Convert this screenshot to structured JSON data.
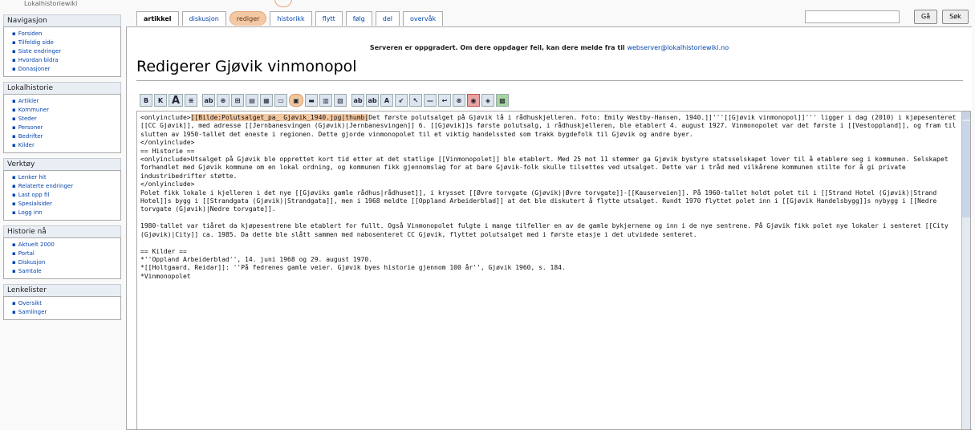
{
  "logo_text": "Lokalhistoriewiki",
  "sidebar": [
    {
      "heading": "Navigasjon",
      "items": [
        "Forsiden",
        "Tilfeldig side",
        "Siste endringer",
        "Hvordan bidra",
        "Donasjoner"
      ]
    },
    {
      "heading": "Lokalhistorie",
      "items": [
        "Artikler",
        "Kommuner",
        "Steder",
        "Personer",
        "Bedrifter",
        "Kilder"
      ]
    },
    {
      "heading": "Verktøy",
      "items": [
        "Lenker hit",
        "Relaterte endringer",
        "Last opp fil",
        "Spesialsider",
        "Logg inn"
      ]
    },
    {
      "heading": "Historie nå",
      "items": [
        "Aktuelt 2000",
        "Portal",
        "Diskusjon",
        "Samtale"
      ]
    },
    {
      "heading": "Lenkelister",
      "items": [
        "Oversikt",
        "Samlinger"
      ]
    }
  ],
  "tabs": [
    "artikkel",
    "diskusjon",
    "rediger",
    "historikk",
    "flytt",
    "følg",
    "del",
    "overvåk"
  ],
  "search": {
    "placeholder": "",
    "go_label": "Gå",
    "search_label": "Søk"
  },
  "notice": {
    "text": "Serveren er oppgradert. Om dere oppdager feil, kan dere melde fra til ",
    "link": "webserver@lokalhistoriewiki.no"
  },
  "page_title": "Redigerer Gjøvik vinmonopol",
  "toolbar": [
    "B",
    "K",
    "A",
    "≡",
    "ab",
    "⊕",
    "⊞",
    "▤",
    "▦",
    "▭",
    "▣",
    "▬",
    "▥",
    "▧",
    "ab",
    "ab",
    "A",
    "↙",
    "↖",
    "—",
    "↩",
    "⊗",
    "◉",
    "◈",
    "▩"
  ],
  "editor": {
    "hl": "[[Bilde:Polutsalget_pa_ Gjøvik_1940.jpg|thumb|",
    "pre": "<onlyinclude>",
    "post": "Det første polutsalget på Gjøvik lå i rådhuskjelleren. Foto: Emily Westby-Hansen, 1940.]]'''[[Gjøvik vinmonopol]]''' ligger i dag (2010) i kjøpesenteret [[CC Gjøvik]], med adresse [[Jernbanesvingen (Gjøvik)|Jernbanesvingen]] 6. [[Gjøvik]]s første polutsalg, i rådhuskjelleren, ble etablert 4. august 1927. Vinmonopolet var det første i [[Vestoppland]], og fram til slutten av 1950-tallet det eneste i regionen. Dette gjorde vinmonopolet til et viktig handelssted som trakk bygdefolk til Gjøvik og andre byer.\n</onlyinclude>\n== Historie ==\n<onlyinclude>Utsalget på Gjøvik ble opprettet kort tid etter at det statlige [[Vinmonopolet]] ble etablert. Med 25 mot 11 stemmer ga Gjøvik bystyre statsselskapet lover til å etablere seg i kommunen. Selskapet forhandlet med Gjøvik kommune om en lokal ordning, og kommunen fikk gjennomslag for at bare Gjøvik-folk skulle tilsettes ved utsalget. Dette var i tråd med vilkårene kommunen stilte for å gi private industribedrifter støtte.\n</onlyinclude>\nPolet fikk lokale i kjelleren i det nye [[Gjøviks gamle rådhus|rådhuset]], i krysset [[Øvre torvgate (Gjøvik)|Øvre torvgate]]-[[Kauserveien]]. På 1960-tallet holdt polet til i [[Strand Hotel (Gjøvik)|Strand Hotel]]s bygg i [[Strandgata (Gjøvik)|Strandgata]], men i 1968 meldte [[Oppland Arbeiderblad]] at det ble diskutert å flytte utsalget. Rundt 1970 flyttet polet inn i [[Gjøvik Handelsbygg]]s nybygg i [[Nedre torvgate (Gjøvik)|Nedre torvgate]].\n\n1980-tallet var tiåret da kjøpesentrene ble etablert for fullt. Også Vinmonopolet fulgte i mange tilfeller en av de gamle bykjernene og inn i de nye sentrene. På Gjøvik fikk polet nye lokaler i senteret [[City (Gjøvik)|City]] ca. 1985. Da dette ble slått sammen med nabosenteret CC Gjøvik, flyttet polutsalget med i første etasje i det utvidede senteret.\n\n== Kilder ==\n*''Oppland Arbeiderblad'', 14. juni 1968 og 29. august 1970.\n*[[Holtgaard, Reidar]]: ''På fedrenes gamle veier. Gjøvik byes historie gjennom 100 år'', Gjøvik 1960, s. 184.\n*Vinmonopolet"
  }
}
